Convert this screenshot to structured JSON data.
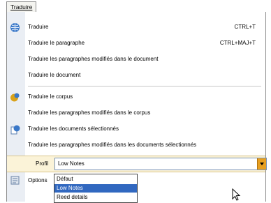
{
  "menu": {
    "title": "Traduire",
    "items": [
      {
        "label": "Traduire",
        "shortcut": "CTRL+T",
        "icon": "globe-icon"
      },
      {
        "label": "Traduire le paragraphe",
        "shortcut": "CTRL+MAJ+T"
      },
      {
        "label": "Traduire les paragraphes modifiés dans le document"
      },
      {
        "label": "Traduire le document"
      },
      {
        "label": "Traduire le corpus",
        "icon": "corpus-icon"
      },
      {
        "label": "Traduire les paragraphes modifiés dans le corpus"
      },
      {
        "label": "Traduire les documents sélectionnés",
        "icon": "documents-icon"
      },
      {
        "label": "Traduire les paragraphes modifiés dans les documents sélectionnés"
      }
    ],
    "profile_label": "Profil",
    "profile_value": "Low Notes",
    "options_label": "Options"
  },
  "dropdown": {
    "options": [
      "Défaut",
      "Low Notes",
      "Reed details"
    ],
    "selected": "Low Notes"
  },
  "colors": {
    "accent": "#e8a020",
    "selection": "#3168c0",
    "profile_bg": "#fbf3d8"
  }
}
